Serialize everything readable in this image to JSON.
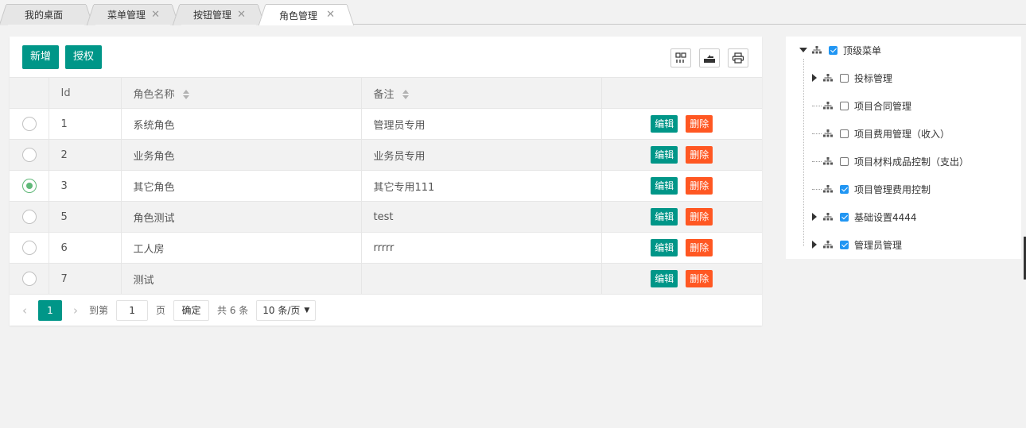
{
  "tabs": [
    {
      "label": "我的桌面",
      "closable": false
    },
    {
      "label": "菜单管理",
      "closable": true
    },
    {
      "label": "按钮管理",
      "closable": true
    },
    {
      "label": "角色管理",
      "closable": true,
      "active": true
    }
  ],
  "toolbar": {
    "add_label": "新增",
    "grant_label": "授权",
    "icons": [
      "columns-icon",
      "export-icon",
      "print-icon"
    ]
  },
  "table": {
    "headers": [
      "Id",
      "角色名称",
      "备注"
    ],
    "edit_label": "编辑",
    "delete_label": "删除",
    "rows": [
      {
        "id": "1",
        "name": "系统角色",
        "note": "管理员专用",
        "selected": false
      },
      {
        "id": "2",
        "name": "业务角色",
        "note": "业务员专用",
        "selected": false
      },
      {
        "id": "3",
        "name": "其它角色",
        "note": "其它专用111",
        "selected": true
      },
      {
        "id": "5",
        "name": "角色测试",
        "note": "test",
        "selected": false
      },
      {
        "id": "6",
        "name": "工人房",
        "note": "rrrrr",
        "selected": false
      },
      {
        "id": "7",
        "name": "测试",
        "note": "",
        "selected": false
      }
    ]
  },
  "pager": {
    "current": "1",
    "goto_label": "到第",
    "page_input": "1",
    "page_unit": "页",
    "confirm_label": "确定",
    "total_label": "共 6 条",
    "page_size": "10 条/页"
  },
  "tree": {
    "root": {
      "label": "顶级菜单",
      "checked": true,
      "expanded": true
    },
    "children": [
      {
        "label": "投标管理",
        "checked": false,
        "has_children": true
      },
      {
        "label": "项目合同管理",
        "checked": false,
        "has_children": false
      },
      {
        "label": "项目费用管理（收入）",
        "checked": false,
        "has_children": false
      },
      {
        "label": "项目材料成品控制（支出）",
        "checked": false,
        "has_children": false
      },
      {
        "label": "项目管理费用控制",
        "checked": true,
        "has_children": false
      },
      {
        "label": "基础设置4444",
        "checked": true,
        "has_children": true
      },
      {
        "label": "管理员管理",
        "checked": true,
        "has_children": true
      }
    ]
  },
  "colors": {
    "primary": "#009688",
    "danger": "#ff5722",
    "radio_on": "#5fb878",
    "checkbox_on": "#2196f3"
  }
}
